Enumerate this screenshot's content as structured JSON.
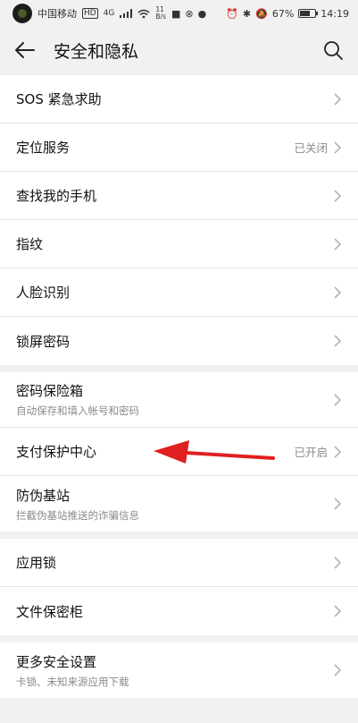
{
  "status_bar": {
    "carrier": "中国移动",
    "hd": "HD",
    "network": "4G",
    "speed_top": "11",
    "speed_bottom": "B/s",
    "battery_percent": "67%",
    "time": "14:19"
  },
  "header": {
    "title": "安全和隐私"
  },
  "groups": [
    {
      "items": [
        {
          "label": "SOS 紧急求助"
        },
        {
          "label": "定位服务",
          "value": "已关闭"
        },
        {
          "label": "查找我的手机"
        },
        {
          "label": "指纹"
        },
        {
          "label": "人脸识别"
        },
        {
          "label": "锁屏密码"
        }
      ]
    },
    {
      "items": [
        {
          "label": "密码保险箱",
          "sub": "自动保存和填入帐号和密码"
        },
        {
          "label": "支付保护中心",
          "value": "已开启"
        },
        {
          "label": "防伪基站",
          "sub": "拦截伪基站推送的诈骗信息"
        }
      ]
    },
    {
      "items": [
        {
          "label": "应用锁"
        },
        {
          "label": "文件保密柜"
        }
      ]
    },
    {
      "items": [
        {
          "label": "更多安全设置",
          "sub": "卡锁、未知来源应用下载"
        }
      ]
    }
  ],
  "colors": {
    "annotation_arrow": "#e02020",
    "background": "#f1f1f1"
  }
}
